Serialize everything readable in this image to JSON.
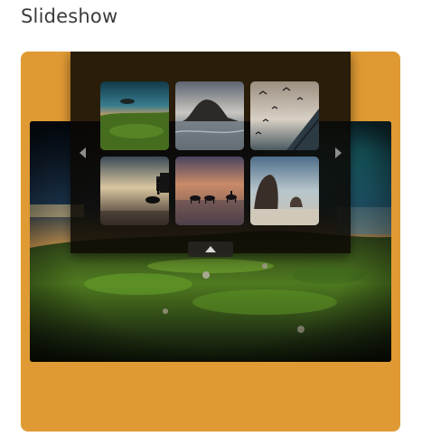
{
  "page": {
    "title": "Slideshow"
  },
  "colors": {
    "slideshow_background": "#DF9A33",
    "panel_background": "#0C0804",
    "arrow": "#8E8E8E"
  },
  "icons": {
    "prev": "chevron-left-icon",
    "next": "chevron-right-icon",
    "toggle": "chevron-up-icon"
  }
}
